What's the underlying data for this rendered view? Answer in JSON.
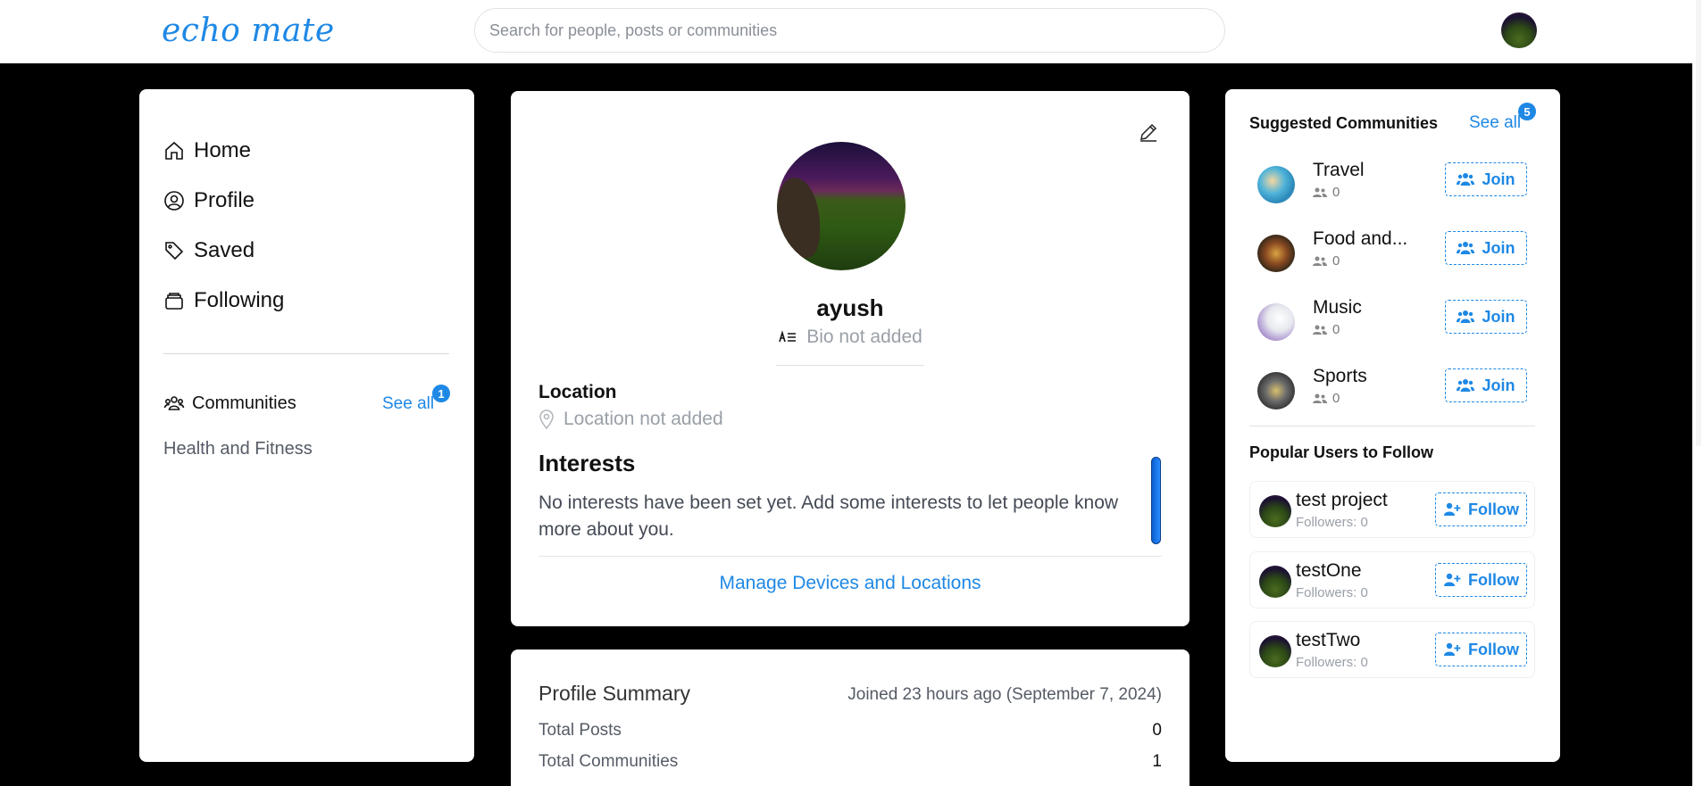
{
  "header": {
    "logo": "echo mate",
    "search_placeholder": "Search for people, posts or communities"
  },
  "sidebar": {
    "items": [
      {
        "label": "Home",
        "icon": "home-icon"
      },
      {
        "label": "Profile",
        "icon": "user-circle-icon"
      },
      {
        "label": "Saved",
        "icon": "tag-icon"
      },
      {
        "label": "Following",
        "icon": "archive-icon"
      }
    ],
    "communities_label": "Communities",
    "see_all": "See all",
    "badge": "1",
    "community_links": [
      "Health and Fitness"
    ]
  },
  "profile": {
    "name": "ayush",
    "bio": "Bio not added",
    "location_label": "Location",
    "location_value": "Location not added",
    "interests_title": "Interests",
    "interests_text": "No interests have been set yet. Add some interests to let people know more about you.",
    "manage_link": "Manage Devices and Locations"
  },
  "summary": {
    "title": "Profile Summary",
    "joined": "Joined 23 hours ago (September 7, 2024)",
    "rows": [
      {
        "label": "Total Posts",
        "value": "0"
      },
      {
        "label": "Total Communities",
        "value": "1"
      }
    ]
  },
  "suggested": {
    "title": "Suggested Communities",
    "see_all": "See all",
    "badge": "5",
    "join_label": "Join",
    "items": [
      {
        "name": "Travel",
        "members": "0"
      },
      {
        "name": "Food and...",
        "members": "0"
      },
      {
        "name": "Music",
        "members": "0"
      },
      {
        "name": "Sports",
        "members": "0"
      }
    ]
  },
  "popular": {
    "title": "Popular Users to Follow",
    "follow_label": "Follow",
    "users": [
      {
        "name": "test project",
        "followers": "Followers: 0"
      },
      {
        "name": "testOne",
        "followers": "Followers: 0"
      },
      {
        "name": "testTwo",
        "followers": "Followers: 0"
      }
    ]
  },
  "colors": {
    "accent": "#1e88e5",
    "background": "#000000",
    "card": "#ffffff"
  }
}
